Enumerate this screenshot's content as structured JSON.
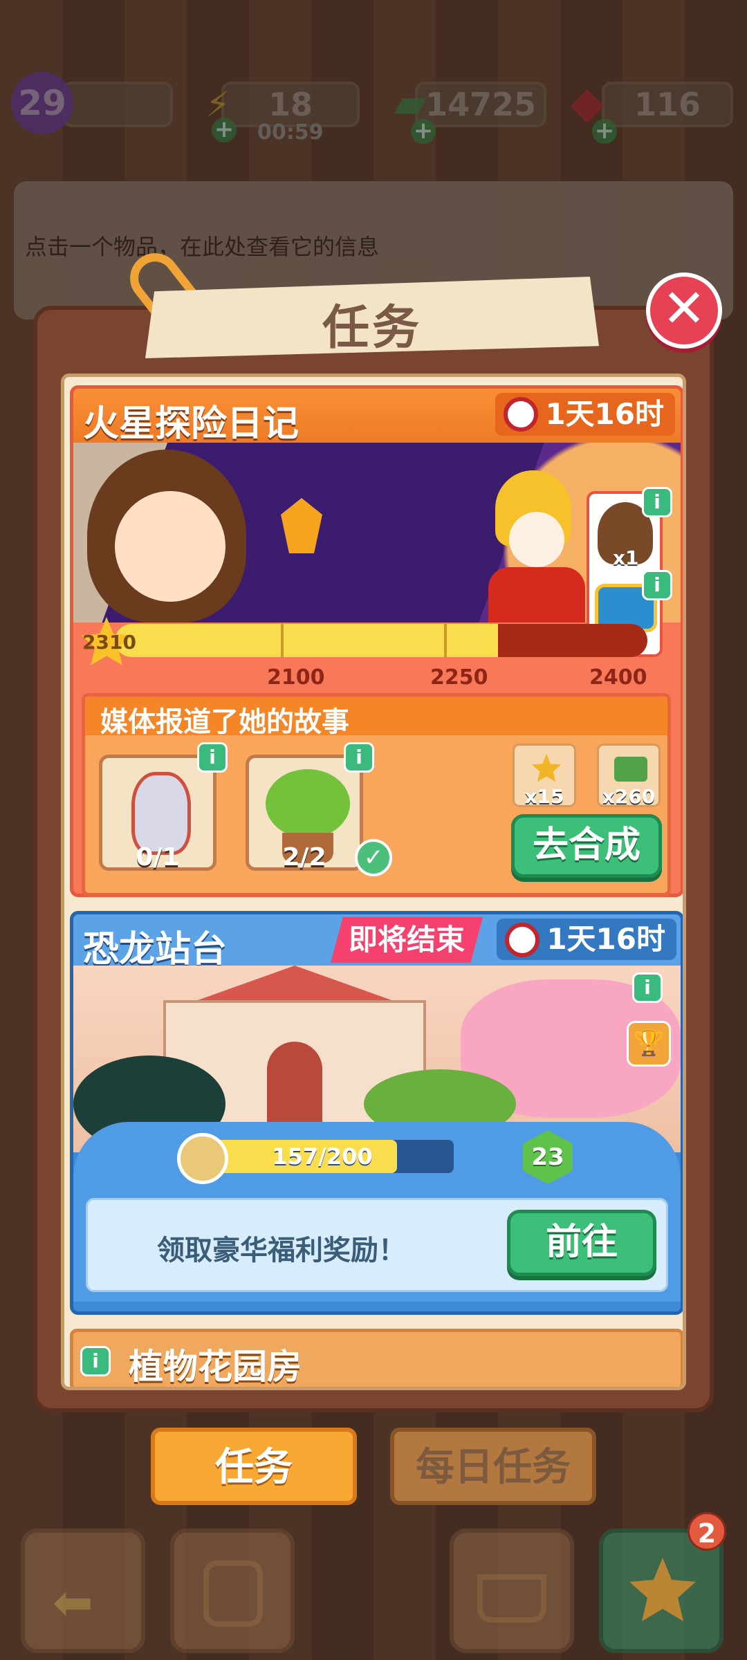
{
  "status": {
    "level": "29",
    "energy": "18",
    "energy_timer": "00:59",
    "cash": "14725",
    "gems": "116"
  },
  "hint_text": "点击一个物品，在此处查看它的信息",
  "dialog": {
    "title": "任务"
  },
  "event_mars": {
    "title": "火星探险日记",
    "timer": "1天16时",
    "rewards": [
      {
        "label": "x1"
      },
      {
        "label": "x1"
      }
    ],
    "progress": {
      "current": "2310",
      "ticks": [
        "2100",
        "2250",
        "2400"
      ],
      "fill_fraction": 0.72
    },
    "task": {
      "title": "媒体报道了她的故事",
      "items": [
        {
          "count": "0/1",
          "done": false
        },
        {
          "count": "2/2",
          "done": true
        }
      ],
      "rewards": [
        {
          "label": "x15"
        },
        {
          "label": "x260"
        }
      ],
      "button": "去合成"
    }
  },
  "event_dino": {
    "title": "恐龙站台",
    "ending_label": "即将结束",
    "timer": "1天16时",
    "progress_text": "157/200",
    "progress_fraction": 0.785,
    "level": "23",
    "claim_text": "领取豪华福利奖励！",
    "button": "前往"
  },
  "event_garden": {
    "title": "植物花园房"
  },
  "tabs": {
    "tasks": "任务",
    "daily": "每日任务"
  },
  "bottom": {
    "badge_count": "2"
  },
  "colors": {
    "accent_green": "#3cc079",
    "event_orange": "#f48628",
    "event_blue": "#3f8ad6",
    "close_red": "#e64154"
  }
}
